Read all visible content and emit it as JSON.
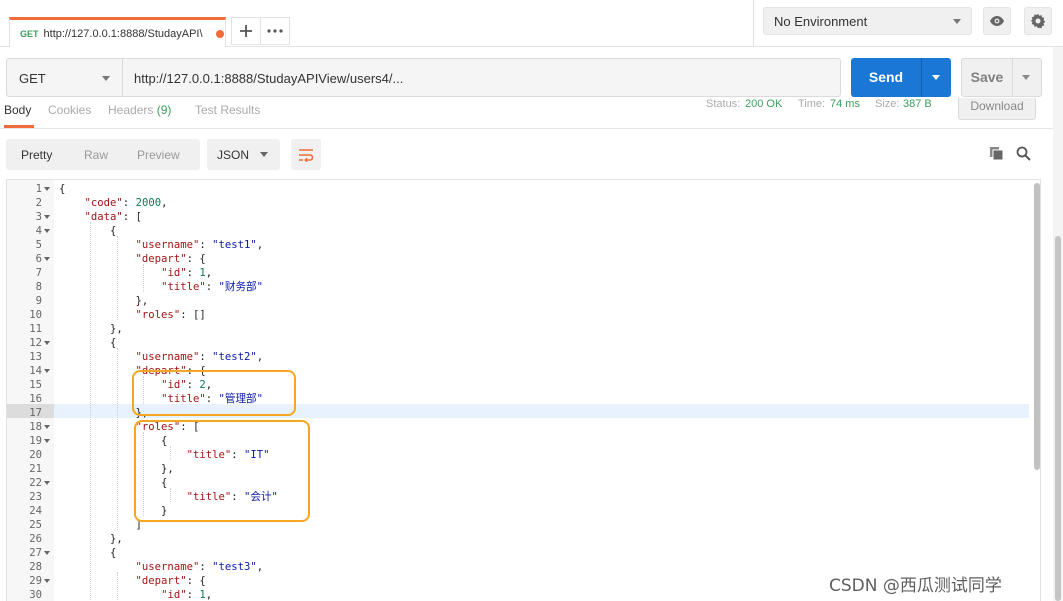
{
  "tab": {
    "method": "GET",
    "title": "http://127.0.0.1:8888/StudayAPI\\"
  },
  "tabbar": {
    "add_icon": "plus-icon",
    "more_icon": "more-icon"
  },
  "environment": {
    "selected": "No Environment"
  },
  "request": {
    "method": "GET",
    "url": "http://127.0.0.1:8888/StudayAPIView/users4/...",
    "send_label": "Send",
    "save_label": "Save"
  },
  "response_tabs": {
    "body": "Body",
    "cookies": "Cookies",
    "headers": "Headers",
    "headers_count": "(9)",
    "test_results": "Test Results",
    "status_label": "Status:",
    "status_value": "200 OK",
    "time_label": "Time:",
    "time_value": "74 ms",
    "size_label": "Size:",
    "size_value": "387 B",
    "download": "Download"
  },
  "view": {
    "pretty": "Pretty",
    "raw": "Raw",
    "preview": "Preview",
    "format": "JSON"
  },
  "code_lines": [
    {
      "n": "1",
      "fold": true,
      "t": "{"
    },
    {
      "n": "2",
      "fold": false,
      "t": "    \"code\": 2000,"
    },
    {
      "n": "3",
      "fold": true,
      "t": "    \"data\": ["
    },
    {
      "n": "4",
      "fold": true,
      "t": "        {"
    },
    {
      "n": "5",
      "fold": false,
      "t": "            \"username\": \"test1\","
    },
    {
      "n": "6",
      "fold": true,
      "t": "            \"depart\": {"
    },
    {
      "n": "7",
      "fold": false,
      "t": "                \"id\": 1,"
    },
    {
      "n": "8",
      "fold": false,
      "t": "                \"title\": \"财务部\""
    },
    {
      "n": "9",
      "fold": false,
      "t": "            },"
    },
    {
      "n": "10",
      "fold": false,
      "t": "            \"roles\": []"
    },
    {
      "n": "11",
      "fold": false,
      "t": "        },"
    },
    {
      "n": "12",
      "fold": true,
      "t": "        {"
    },
    {
      "n": "13",
      "fold": false,
      "t": "            \"username\": \"test2\","
    },
    {
      "n": "14",
      "fold": true,
      "t": "            \"depart\": {"
    },
    {
      "n": "15",
      "fold": false,
      "t": "                \"id\": 2,"
    },
    {
      "n": "16",
      "fold": false,
      "t": "                \"title\": \"管理部\""
    },
    {
      "n": "17",
      "fold": false,
      "t": "            },"
    },
    {
      "n": "18",
      "fold": true,
      "t": "            \"roles\": ["
    },
    {
      "n": "19",
      "fold": true,
      "t": "                {"
    },
    {
      "n": "20",
      "fold": false,
      "t": "                    \"title\": \"IT\""
    },
    {
      "n": "21",
      "fold": false,
      "t": "                },"
    },
    {
      "n": "22",
      "fold": true,
      "t": "                {"
    },
    {
      "n": "23",
      "fold": false,
      "t": "                    \"title\": \"会计\""
    },
    {
      "n": "24",
      "fold": false,
      "t": "                }"
    },
    {
      "n": "25",
      "fold": false,
      "t": "            ]"
    },
    {
      "n": "26",
      "fold": false,
      "t": "        },"
    },
    {
      "n": "27",
      "fold": true,
      "t": "        {"
    },
    {
      "n": "28",
      "fold": false,
      "t": "            \"username\": \"test3\","
    },
    {
      "n": "29",
      "fold": true,
      "t": "            \"depart\": {"
    },
    {
      "n": "30",
      "fold": false,
      "t": "                \"id\": 1,"
    }
  ],
  "highlighted_line": "17",
  "annotation_color": "#f5a623",
  "accent": "#f26b3a",
  "send_color": "#1b77d6",
  "watermark": "CSDN @西瓜测试同学"
}
